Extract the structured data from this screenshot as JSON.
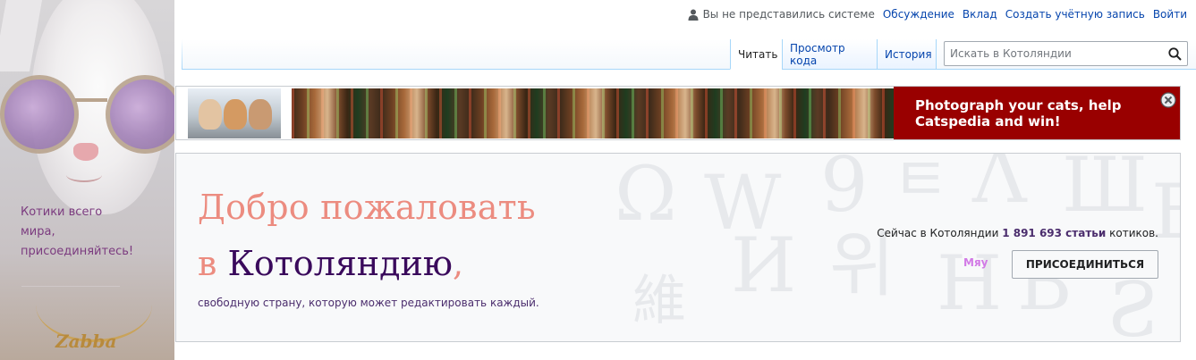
{
  "sidebar": {
    "tagline": [
      "Котики всего",
      "мира,",
      "присоединяйтесь!"
    ],
    "pendant_text": "Zabba"
  },
  "personal_tools": {
    "status": "Вы не представились системе",
    "links": [
      "Обсуждение",
      "Вклад",
      "Создать учётную запись",
      "Войти"
    ]
  },
  "tabs": [
    {
      "label": "Читать",
      "selected": true
    },
    {
      "label": "Просмотр кода",
      "selected": false
    },
    {
      "label": "История",
      "selected": false
    }
  ],
  "search": {
    "placeholder": "Искать в Котоляндии",
    "icon": "search-icon"
  },
  "banner": {
    "text": "Photograph your cats, help Catspedia and win!",
    "bg_color": "#990000",
    "close_icon": "close-circle-icon"
  },
  "welcome": {
    "title_line1": "Добро пожаловать",
    "title_prefix": "в",
    "title_name": "Котоляндию",
    "title_comma": ",",
    "subtitle": "свободную страну, которую может редактировать каждый.",
    "count_prefix": "Сейчас в Котоляндии",
    "count_value": "1 891 693 статьи",
    "count_suffix": "котиков.",
    "meow": "Мяу",
    "join_button": "ПРИСОЕДИНИТЬСЯ"
  },
  "colors": {
    "link": "#0645ad",
    "title_accent": "#ec8c80",
    "title_name": "#3a0a5c",
    "banner_red": "#990000"
  }
}
